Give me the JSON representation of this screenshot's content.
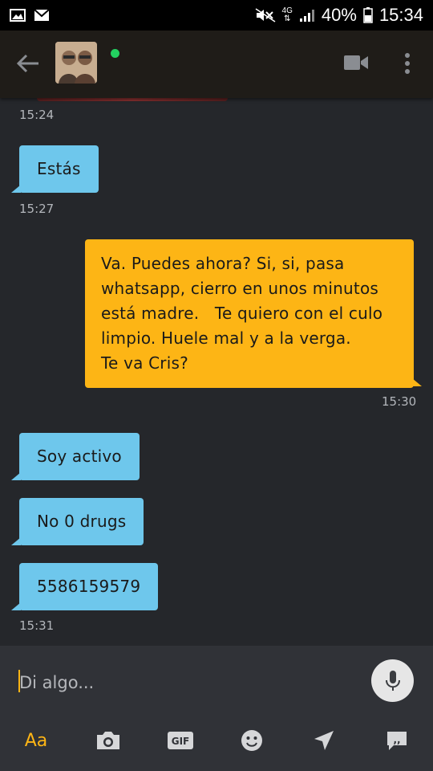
{
  "status_bar": {
    "network": "4G",
    "battery": "40%",
    "time": "15:34"
  },
  "header": {
    "back_icon": "arrow-left-icon",
    "online": true,
    "video_icon": "video-camera-icon",
    "more_icon": "more-vertical-icon"
  },
  "messages": [
    {
      "type": "timestamp",
      "text": "15:24"
    },
    {
      "type": "in",
      "text": "Estás"
    },
    {
      "type": "timestamp",
      "text": "15:27"
    },
    {
      "type": "out",
      "lines": [
        "Va. Puedes ahora? Si, si, pasa",
        "whatsapp, cierro en unos minutos",
        "está madre.   Te quiero con el culo",
        "limpio. Huele mal y a la verga.",
        "Te va Cris?"
      ]
    },
    {
      "type": "timestamp",
      "text": "15:30"
    },
    {
      "type": "in",
      "text": "Soy activo"
    },
    {
      "type": "in",
      "text": "No 0 drugs"
    },
    {
      "type": "in",
      "text": "5586159579"
    },
    {
      "type": "timestamp",
      "text": "15:31"
    }
  ],
  "input": {
    "placeholder": "Di algo...",
    "value": ""
  },
  "toolbar": {
    "text_label": "Aa",
    "gif_label": "GIF",
    "items": [
      "text-format-icon",
      "camera-icon",
      "gif-icon",
      "emoji-icon",
      "send-location-icon",
      "saved-phrases-icon"
    ]
  },
  "colors": {
    "incoming_bubble": "#6ec7ec",
    "outgoing_bubble": "#fdb515",
    "background": "#25272b",
    "accent": "#fdb515",
    "online": "#23d160"
  }
}
